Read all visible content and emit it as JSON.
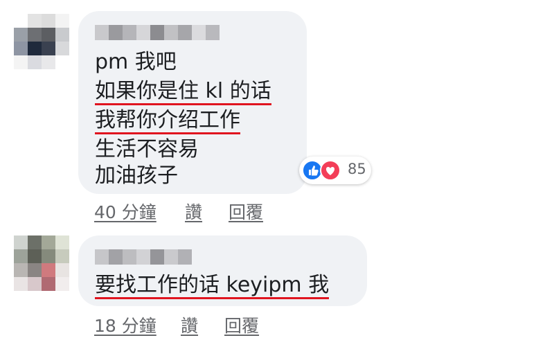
{
  "comments": [
    {
      "author_redacted": true,
      "lines": [
        {
          "text": "pm 我吧",
          "underlined": false
        },
        {
          "text": "如果你是住 kl 的话",
          "underlined": true
        },
        {
          "text": "我帮你介绍工作",
          "underlined": true
        },
        {
          "text": "生活不容易",
          "underlined": false
        },
        {
          "text": "加油孩子",
          "underlined": false
        }
      ],
      "reactions": {
        "icons": [
          "like-icon",
          "love-icon"
        ],
        "count": "85"
      },
      "time": "40 分鐘",
      "like_label": "讚",
      "reply_label": "回覆"
    },
    {
      "author_redacted": true,
      "lines": [
        {
          "text": "要找工作的话 keyipm 我",
          "underlined": true
        }
      ],
      "time": "18 分鐘",
      "like_label": "讚",
      "reply_label": "回覆"
    }
  ],
  "colors": {
    "bubble": "#f0f2f5",
    "underline": "#e0141f",
    "like": "#1877f2",
    "love": "#f33e58",
    "meta_text": "#65676b"
  }
}
